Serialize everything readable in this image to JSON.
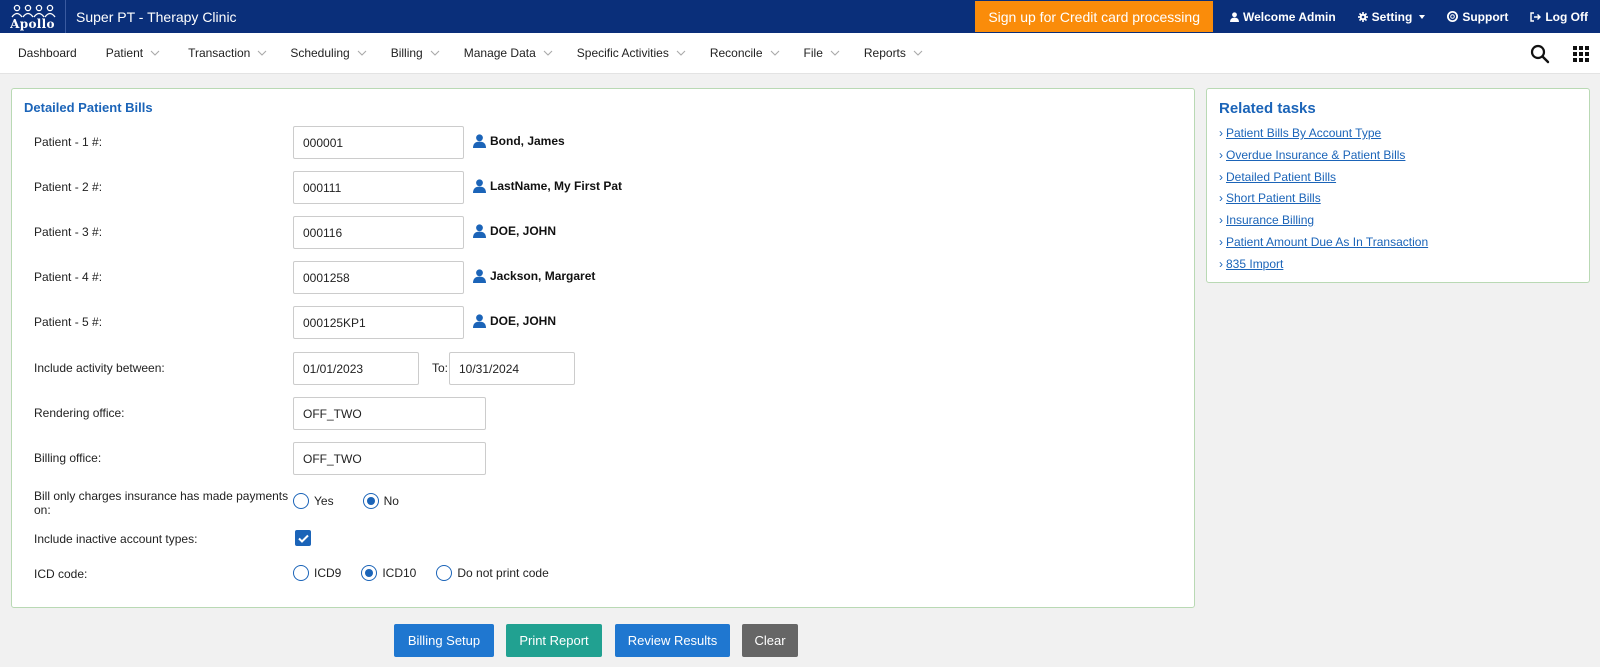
{
  "header": {
    "logo_text": "Apollo",
    "clinic_name": "Super PT - Therapy Clinic",
    "signup_label": "Sign up for Credit card processing",
    "welcome_label": "Welcome Admin",
    "setting_label": "Setting",
    "support_label": "Support",
    "logoff_label": "Log Off",
    "brand_color": "#0a2f7a",
    "signup_color": "#fa8c0a"
  },
  "menu": {
    "items": [
      {
        "label": "Dashboard"
      },
      {
        "label": "Patient"
      },
      {
        "label": "Transaction"
      },
      {
        "label": "Scheduling"
      },
      {
        "label": "Billing"
      },
      {
        "label": "Manage Data"
      },
      {
        "label": "Specific Activities"
      },
      {
        "label": "Reconcile"
      },
      {
        "label": "File"
      },
      {
        "label": "Reports"
      }
    ],
    "icons": [
      "search-icon",
      "apps-grid-icon"
    ]
  },
  "form": {
    "title": "Detailed Patient Bills",
    "patients": [
      {
        "label": "Patient - 1 #:",
        "value": "000001",
        "name": "Bond, James"
      },
      {
        "label": "Patient - 2 #:",
        "value": "000111",
        "name": "LastName, My First Pat"
      },
      {
        "label": "Patient - 3 #:",
        "value": "000116",
        "name": "DOE, JOHN"
      },
      {
        "label": "Patient - 4 #:",
        "value": "0001258",
        "name": "Jackson, Margaret"
      },
      {
        "label": "Patient - 5 #:",
        "value": "000125KP1",
        "name": "DOE, JOHN"
      }
    ],
    "activity_label": "Include activity between:",
    "date_from": "01/01/2023",
    "to_label": "To:",
    "date_to": "10/31/2024",
    "rendering_label": "Rendering office:",
    "rendering_value": "OFF_TWO",
    "billing_label": "Billing office:",
    "billing_value": "OFF_TWO",
    "bill_only_label_1": "Bill only charges insurance has made payments",
    "bill_only_label_2": "on:",
    "bill_only_yes": "Yes",
    "bill_only_no": "No",
    "inactive_label": "Include inactive account types:",
    "icd_label": "ICD code:",
    "icd9": "ICD9",
    "icd10": "ICD10",
    "icd_none": "Do not print code"
  },
  "buttons": {
    "billing_setup": "Billing Setup",
    "print_report": "Print Report",
    "review_results": "Review Results",
    "clear": "Clear"
  },
  "related": {
    "title": "Related tasks",
    "tasks": [
      "Patient Bills By Account Type",
      "Overdue Insurance & Patient Bills",
      "Detailed Patient Bills",
      "Short Patient Bills",
      "Insurance Billing",
      "Patient Amount Due As In Transaction",
      "835 Import"
    ]
  }
}
